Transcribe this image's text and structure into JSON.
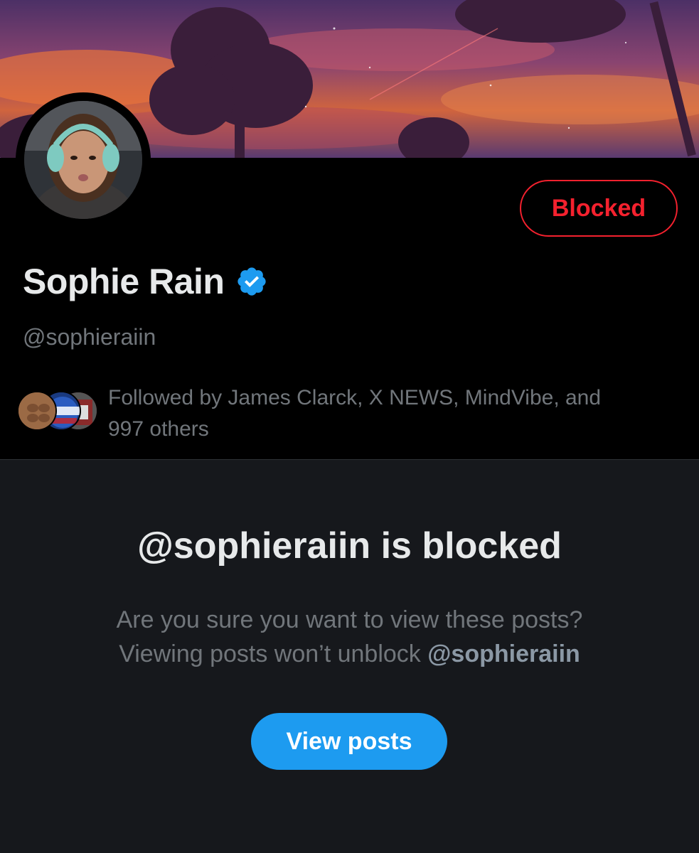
{
  "profile": {
    "display_name": "Sophie Rain",
    "handle": "@sophieraiin",
    "block_status_button": "Blocked",
    "verified_icon": "verified-badge-icon"
  },
  "followed_by": {
    "text_line1": "Followed by James Clarck, X NEWS, MindVibe, and",
    "text_line2": "997 others"
  },
  "blocked_notice": {
    "title": "@sophieraiin is blocked",
    "line1": "Are you sure you want to view these posts?",
    "line2_prefix": "Viewing posts won’t unblock ",
    "line2_handle": "@sophieraiin",
    "view_button": "View posts"
  },
  "colors": {
    "background": "#000000",
    "panel": "#16181c",
    "blocked_red": "#f4212e",
    "accent_blue": "#1d9bf0",
    "muted_text": "#71767b"
  }
}
